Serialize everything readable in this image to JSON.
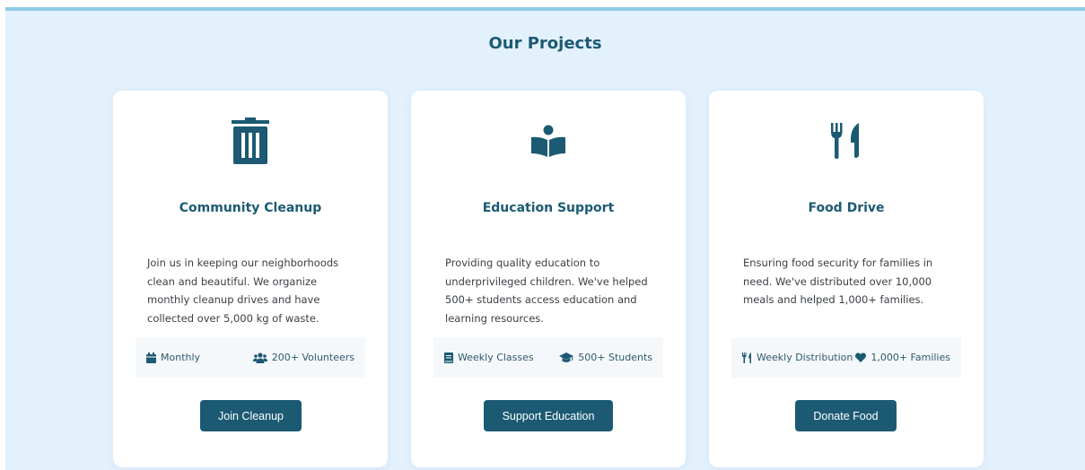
{
  "section": {
    "title": "Our Projects"
  },
  "colors": {
    "accent": "#1c5a73",
    "background": "#e3f1fd",
    "top_border": "#8ecbe7",
    "card": "#ffffff",
    "meta_bg": "#f5f8fa"
  },
  "projects": [
    {
      "icon": "trash-icon",
      "title": "Community Cleanup",
      "description": "Join us in keeping our neighborhoods clean and beautiful. We organize monthly cleanup drives and have collected over 5,000 kg of waste.",
      "meta": [
        {
          "icon": "calendar-icon",
          "label": "Monthly"
        },
        {
          "icon": "users-icon",
          "label": "200+ Volunteers"
        }
      ],
      "button_label": "Join Cleanup"
    },
    {
      "icon": "book-reader-icon",
      "title": "Education Support",
      "description": "Providing quality education to underprivileged children. We've helped 500+ students access education and learning resources.",
      "meta": [
        {
          "icon": "book-icon",
          "label": "Weekly Classes"
        },
        {
          "icon": "graduation-cap-icon",
          "label": "500+ Students"
        }
      ],
      "button_label": "Support Education"
    },
    {
      "icon": "utensils-icon",
      "title": "Food Drive",
      "description": "Ensuring food security for families in need. We've distributed over 10,000 meals and helped 1,000+ families.",
      "meta": [
        {
          "icon": "utensils-icon",
          "label": "Weekly Distribution"
        },
        {
          "icon": "heart-icon",
          "label": "1,000+ Families"
        }
      ],
      "button_label": "Donate Food"
    }
  ]
}
